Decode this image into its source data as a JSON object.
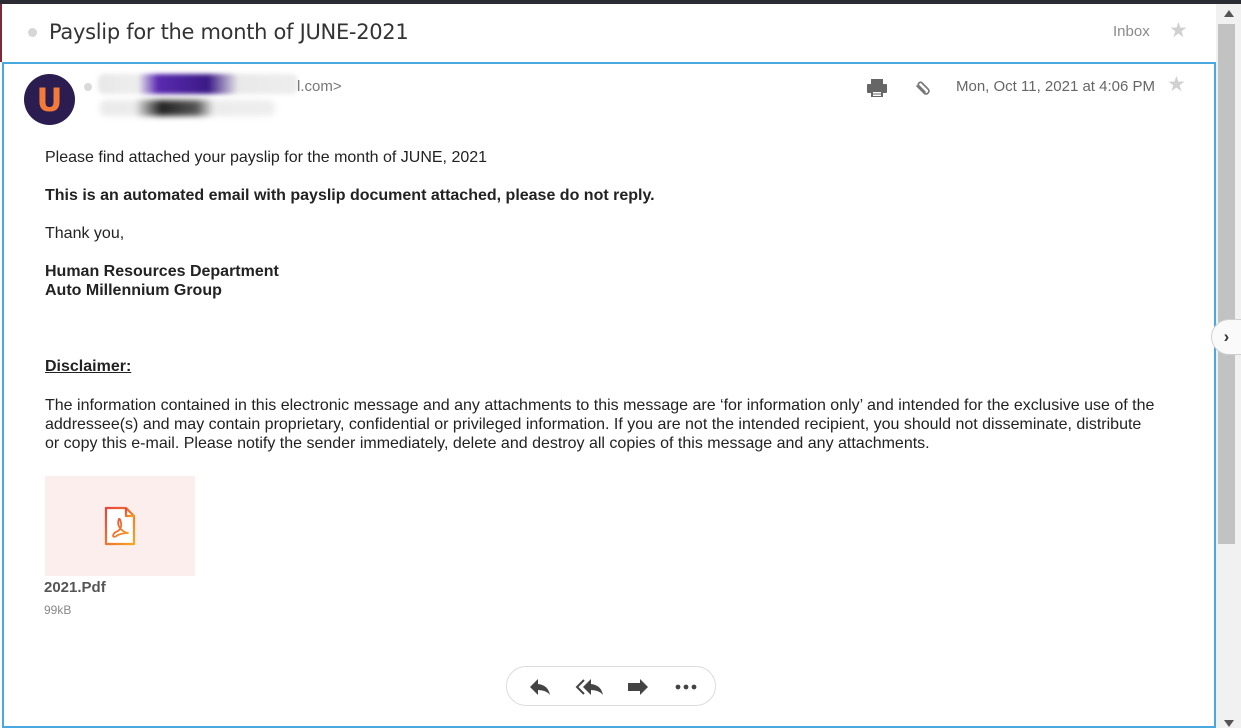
{
  "subject": {
    "title": "Payslip for the month of JUNE-2021",
    "folder": "Inbox"
  },
  "message": {
    "avatar_letter": "U",
    "sender_email_visible": "l.com>",
    "date": "Mon, Oct 11, 2021 at 4:06 PM",
    "body": {
      "line1": "Please find attached your payslip for the month of JUNE, 2021",
      "line2": "This is an automated email with payslip document attached, please do not reply.",
      "line3": "Thank you,",
      "signature_line1": "Human Resources Department",
      "signature_line2": "Auto Millennium Group",
      "disclaimer_heading": "Disclaimer:",
      "disclaimer_text": "The information contained in this electronic message and any attachments to this message are ‘for information only’ and intended for the exclusive use of the addressee(s) and may contain proprietary, confidential or privileged information. If you are not the intended recipient, you should not disseminate, distribute or copy this e-mail. Please notify the sender immediately, delete and destroy all copies of this message and any attachments."
    },
    "attachment": {
      "name": "2021.Pdf",
      "size": "99kB"
    }
  },
  "actions": [
    "reply",
    "reply-all",
    "forward",
    "more"
  ],
  "icons": {
    "star": "star-icon",
    "print": "print-icon",
    "attachment": "paperclip-icon",
    "pdf": "pdf-icon",
    "next": "chevron-right-icon"
  },
  "colors": {
    "focus_border": "#4aa8e0",
    "avatar_bg": "#2b1d4f",
    "avatar_letter": "#f47a3a",
    "pdf_accent": "#e8453c",
    "attachment_bg": "#fbeeec"
  }
}
